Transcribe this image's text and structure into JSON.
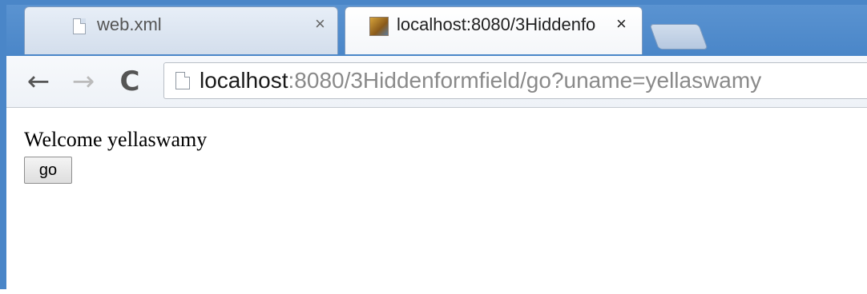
{
  "browser": {
    "tabs": [
      {
        "title": "web.xml",
        "close_glyph": "×",
        "icon": "page-icon",
        "active": false
      },
      {
        "title": "localhost:8080/3Hiddenfo",
        "close_glyph": "×",
        "icon": "tomcat-favicon-icon",
        "active": true
      }
    ],
    "toolbar": {
      "back_glyph": "←",
      "forward_glyph": "→",
      "reload_glyph": "C"
    },
    "omnibox": {
      "url_host": "localhost",
      "url_rest": ":8080/3Hiddenformfield/go?uname=yellaswamy"
    }
  },
  "page": {
    "welcome_text": "Welcome yellaswamy",
    "go_button_label": "go"
  },
  "colors": {
    "frame_accent": "#4a86c8",
    "url_host": "#1a1a1a",
    "url_rest": "#8a8a8a"
  }
}
